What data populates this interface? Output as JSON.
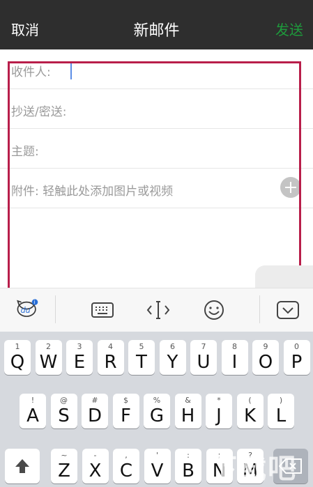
{
  "nav": {
    "cancel_label": "取消",
    "title": "新邮件",
    "send_label": "发送"
  },
  "form": {
    "to_label": "收件人:",
    "cc_label": "抄送/密送:",
    "subject_label": "主题:",
    "attachment_label": "附件: 轻触此处添加图片或视频"
  },
  "toolbar": {
    "icons": [
      "du-keyboard-logo-icon",
      "keyboard-icon",
      "cursor-move-icon",
      "emoji-icon",
      "collapse-keyboard-icon"
    ]
  },
  "keyboard": {
    "row1": [
      {
        "main": "Q",
        "sub": "1"
      },
      {
        "main": "W",
        "sub": "2"
      },
      {
        "main": "E",
        "sub": "3"
      },
      {
        "main": "R",
        "sub": "4"
      },
      {
        "main": "T",
        "sub": "5"
      },
      {
        "main": "Y",
        "sub": "6"
      },
      {
        "main": "U",
        "sub": "7"
      },
      {
        "main": "I",
        "sub": "8"
      },
      {
        "main": "O",
        "sub": "9"
      },
      {
        "main": "P",
        "sub": "0"
      }
    ],
    "row2": [
      {
        "main": "A",
        "sub": "!"
      },
      {
        "main": "S",
        "sub": "@"
      },
      {
        "main": "D",
        "sub": "#"
      },
      {
        "main": "F",
        "sub": "$"
      },
      {
        "main": "G",
        "sub": "%"
      },
      {
        "main": "H",
        "sub": "&"
      },
      {
        "main": "J",
        "sub": "*"
      },
      {
        "main": "K",
        "sub": "("
      },
      {
        "main": "L",
        "sub": ")"
      }
    ],
    "row3": [
      {
        "main": "Z",
        "sub": "~"
      },
      {
        "main": "X",
        "sub": "-"
      },
      {
        "main": "C",
        "sub": ","
      },
      {
        "main": "V",
        "sub": "'"
      },
      {
        "main": "B",
        "sub": ":"
      },
      {
        "main": "N",
        "sub": ";"
      },
      {
        "main": "M",
        "sub": "?"
      }
    ]
  },
  "watermark": {
    "text": "下载吧"
  },
  "colors": {
    "nav_bg": "#2e2e2e",
    "send": "#1e9a3c",
    "highlight": "#b81e4a",
    "caret": "#5b8de6"
  }
}
